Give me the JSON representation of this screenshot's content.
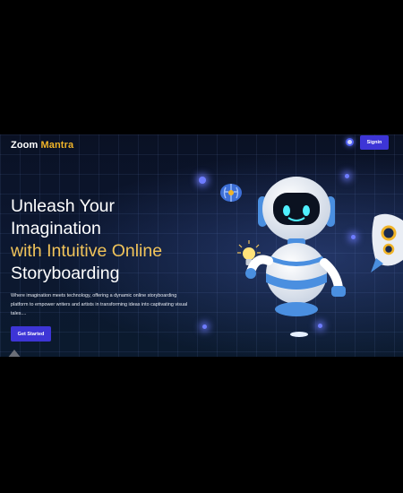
{
  "header": {
    "logo_text": "Zoom",
    "logo_accent": "Mantra",
    "signin_label": "Signin"
  },
  "hero": {
    "line1": "Unleash Your",
    "line2": "Imagination",
    "line3": "with Intuitive Online",
    "line4": "Storyboarding",
    "description": "Where imagination meets technology, offering a dynamic online storyboarding platform to empower writers and artists in transforming ideas into captivating visual tales....",
    "cta_label": "Get Started"
  },
  "icons": {
    "theme_toggle": "moon-icon",
    "robot": "robot-mascot",
    "brain": "brain-icon",
    "bulb": "lightbulb-icon",
    "rocket": "rocket-icon"
  },
  "colors": {
    "accent": "#f0b429",
    "button": "#3d35d6",
    "background": "#0c1730",
    "robot_blue": "#4a8fe0"
  }
}
